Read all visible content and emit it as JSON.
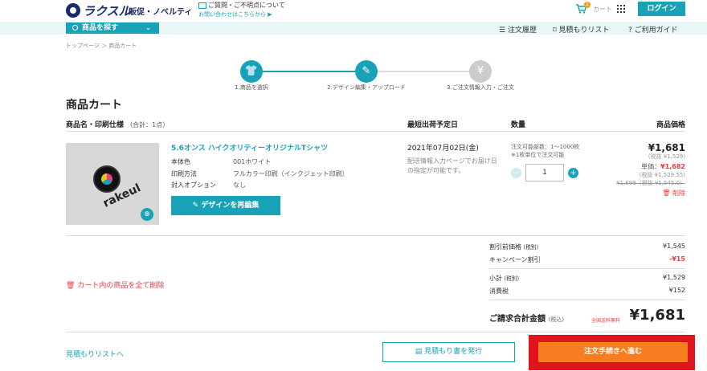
{
  "header": {
    "logo": "ラクスル",
    "logo_sub": "販促・ノベルティ",
    "inquiry_line1": "ご質問・ご不明点について",
    "inquiry_line2": "お問い合わせはこちらから ▶",
    "cart_count": "1",
    "cart_label": "カート",
    "login_label": "ログイン"
  },
  "navbar": {
    "search_category": "商品を探す",
    "items": [
      {
        "label": "注文履歴",
        "icon": "list-icon"
      },
      {
        "label": "見積もりリスト",
        "icon": "bookmark-icon"
      },
      {
        "label": "ご利用ガイド",
        "icon": "question-icon"
      }
    ]
  },
  "breadcrumb": "トップページ ＞ 商品カート",
  "steps": [
    {
      "label": "1.商品を選択",
      "icon": "tshirt-icon",
      "color": "#17a2b8"
    },
    {
      "label": "2.デザイン編集・アップロード",
      "icon": "pencil-icon",
      "color": "#17a2b8"
    },
    {
      "label": "3.ご注文情報入力・ご注文",
      "icon": "yen-icon",
      "color": "#cccccc"
    }
  ],
  "page_title": "商品カート",
  "columns": {
    "product": "商品名・印刷仕様",
    "product_count": "（合計：1点）",
    "ship_date": "最短出荷予定日",
    "quantity": "数量",
    "price": "商品価格"
  },
  "product": {
    "name": "5.6オンス ハイクオリティーオリジナルTシャツ",
    "image_text": "rakeul",
    "specs": [
      {
        "label": "本体色",
        "value": "001ホワイト"
      },
      {
        "label": "印刷方法",
        "value": "フルカラー印刷（インクジェット印刷）"
      },
      {
        "label": "封入オプション",
        "value": "なし"
      }
    ],
    "redesign_label": "デザインを再編集",
    "ship_date": "2021年07月02日(金)",
    "ship_note": "配送情報入力ページでお届け日の指定が可能です。",
    "qty_note1": "注文可能部数：1〜1000枚",
    "qty_note2": "※1枚単位で注文可能",
    "quantity": "1",
    "price": "¥1,681",
    "price_tax": "(税抜 ¥1,529)",
    "unit_label": "単価：",
    "unit_price": "¥1,682",
    "unit_tax": "(税抜 ¥1,529.55)",
    "old_price": "¥1,699（税抜 ¥1,545.0）",
    "delete_label": "削除"
  },
  "summary": {
    "pre_discount_label": "割引前価格",
    "pre_discount_tax": "(税別)",
    "pre_discount_value": "¥1,545",
    "campaign_label": "キャンペーン割引",
    "campaign_value": "-¥15",
    "subtotal_label": "小計",
    "subtotal_tax": "(税別)",
    "subtotal_value": "¥1,529",
    "tax_label": "消費税",
    "tax_value": "¥152",
    "total_label": "ご請求合計金額",
    "total_tax": "(税込)",
    "free_shipping": "全国送料無料",
    "total_value": "¥1,681",
    "delete_all": "カート内の商品を全て削除"
  },
  "footer": {
    "quote_list": "見積もりリストへ",
    "quote_button": "見積もり書を発行",
    "checkout_button": "注文手続きへ進む"
  }
}
